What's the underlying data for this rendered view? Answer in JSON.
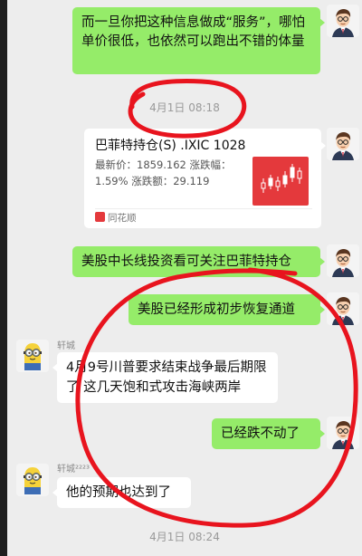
{
  "messages": {
    "m1": "而一旦你把这种信息做成“服务”，哪怕单价很低，也依然可以跑出不错的体量",
    "ts1": "4月1日 08:18",
    "card": {
      "title": "巴菲特持仓(S)  .IXIC 1028",
      "line1": "最新价：1859.162  涨跌幅：",
      "line2": "1.59%  涨跌额：29.119",
      "source": "同花顺",
      "thumb_color": "#e4393c"
    },
    "m3": "美股中长线投资看可关注巴菲特持仓",
    "m4": "美股已经形成初步恢复通道",
    "sender1": "轩城",
    "m5": "4月9号川普要求结束战争最后期限了 这几天饱和式攻击海峡两岸",
    "m6": "已经跌不动了",
    "sender2": "轩城²²²³",
    "m7": "他的预期也达到了",
    "ts2": "4月1日 08:24"
  },
  "colors": {
    "green_bubble": "#95ec69",
    "chat_bg": "#ededed",
    "annotation": "#e8141e"
  }
}
